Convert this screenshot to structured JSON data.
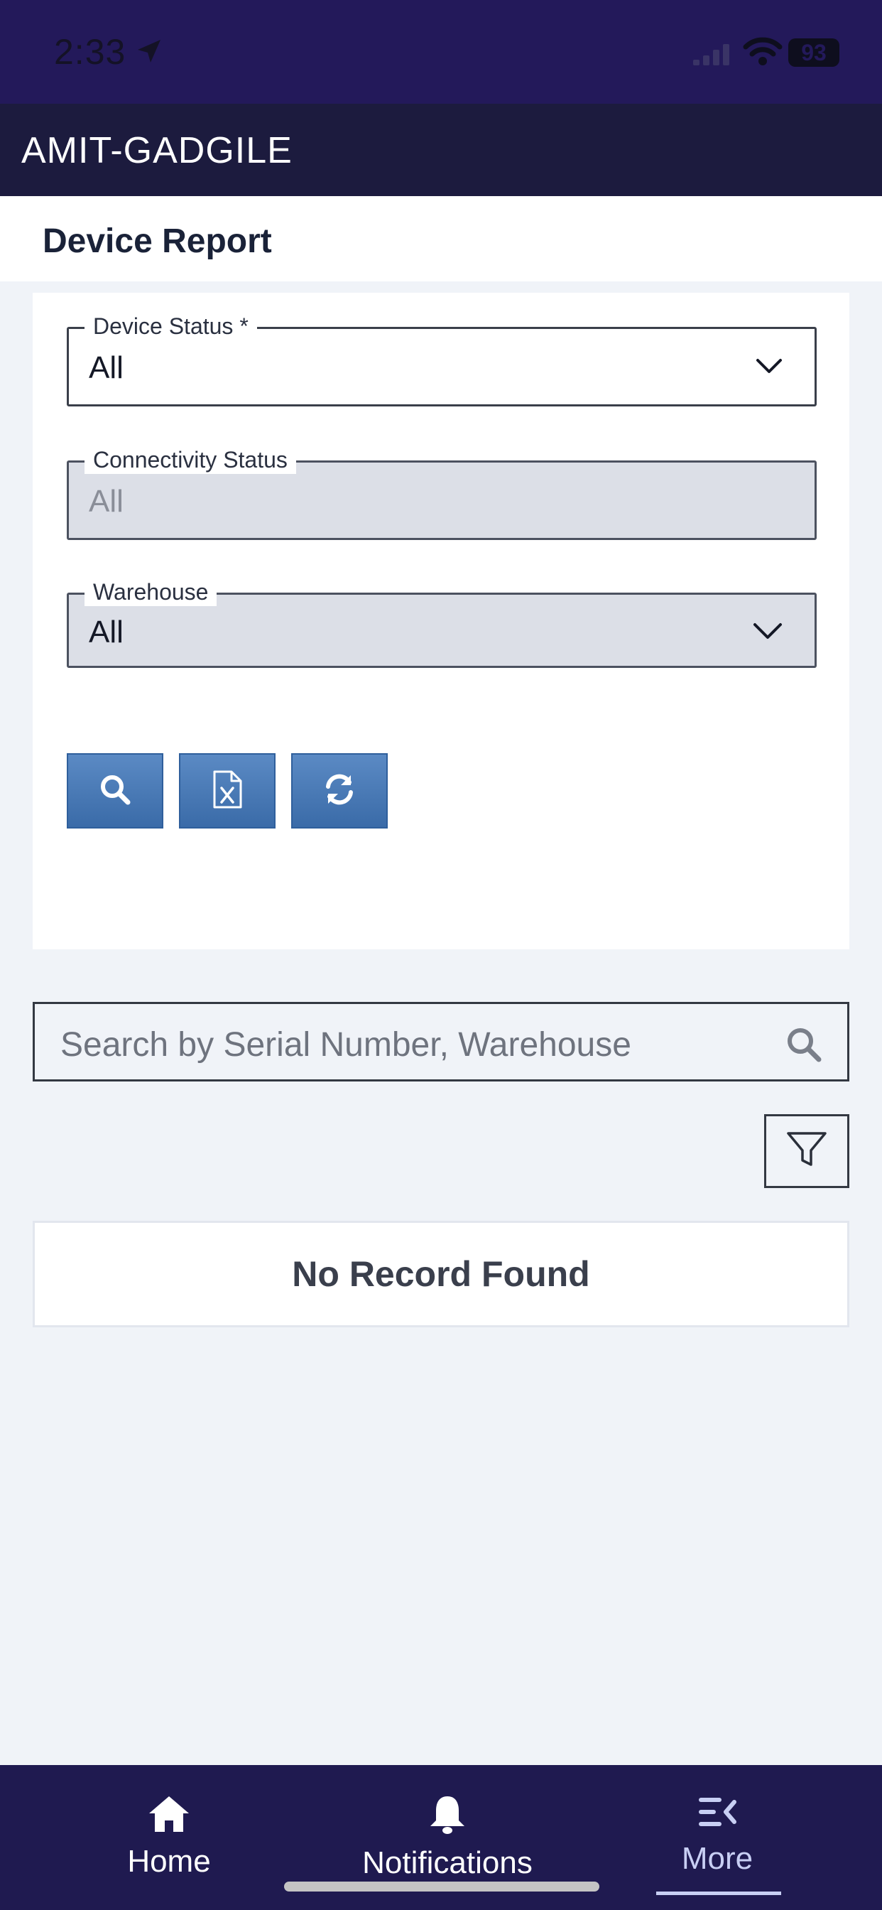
{
  "status_bar": {
    "time": "2:33",
    "battery": "93"
  },
  "header": {
    "title": "AMIT-GADGILE"
  },
  "page": {
    "title": "Device Report"
  },
  "filters": {
    "device_status": {
      "label": "Device Status *",
      "value": "All"
    },
    "connectivity_status": {
      "label": "Connectivity Status",
      "value": "All"
    },
    "warehouse": {
      "label": "Warehouse",
      "value": "All"
    }
  },
  "actions": {
    "buttons": [
      {
        "icon": "search-icon"
      },
      {
        "icon": "excel-file-icon"
      },
      {
        "icon": "refresh-icon"
      }
    ]
  },
  "search": {
    "placeholder": "Search by Serial Number, Warehouse"
  },
  "results": {
    "empty_message": "No Record Found"
  },
  "bottom_nav": {
    "items": [
      {
        "label": "Home",
        "icon": "home-icon"
      },
      {
        "label": "Notifications",
        "icon": "bell-icon"
      },
      {
        "label": "More",
        "icon": "menu-more-icon",
        "active": true
      }
    ]
  },
  "colors": {
    "status_bar_bg": "#23195a",
    "header_bg": "#1c1b3e",
    "button_blue": "#4a7bb7",
    "nav_bg": "#1f1a50",
    "page_bg": "#f0f3f8"
  }
}
